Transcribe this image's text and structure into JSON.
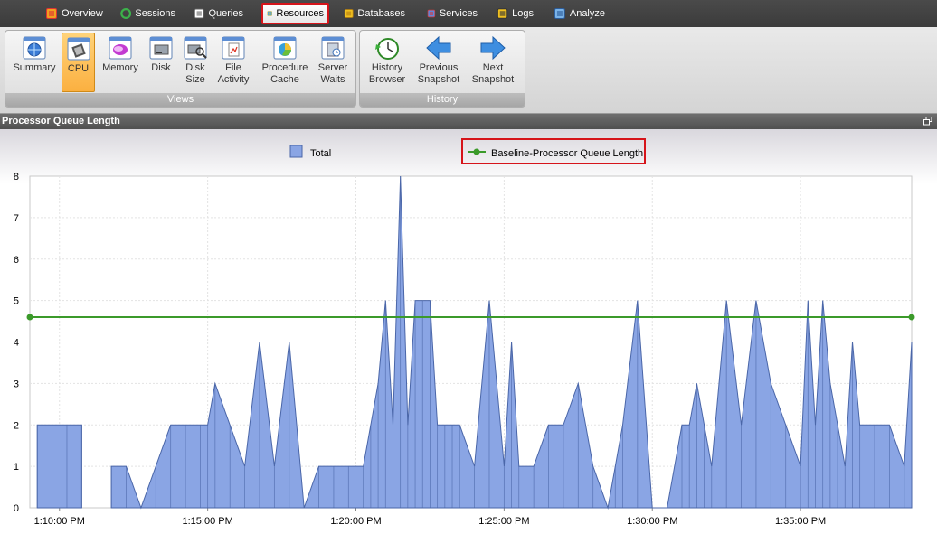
{
  "tabs": [
    {
      "label": "Overview",
      "icon": "overview-icon",
      "active": false
    },
    {
      "label": "Sessions",
      "icon": "sessions-icon",
      "active": false
    },
    {
      "label": "Queries",
      "icon": "queries-icon",
      "active": false
    },
    {
      "label": "Resources",
      "icon": "resources-icon",
      "active": true
    },
    {
      "label": "Databases",
      "icon": "databases-icon",
      "active": false
    },
    {
      "label": "Services",
      "icon": "services-icon",
      "active": false
    },
    {
      "label": "Logs",
      "icon": "logs-icon",
      "active": false
    },
    {
      "label": "Analyze",
      "icon": "analyze-icon",
      "active": false
    }
  ],
  "ribbon": {
    "views": {
      "label": "Views",
      "buttons": [
        {
          "line1": "Summary",
          "line2": "",
          "icon": "globe-icon",
          "active": false
        },
        {
          "line1": "CPU",
          "line2": "",
          "icon": "cpu-chip-icon",
          "active": true
        },
        {
          "line1": "Memory",
          "line2": "",
          "icon": "memory-icon",
          "active": false
        },
        {
          "line1": "Disk",
          "line2": "",
          "icon": "disk-icon",
          "active": false
        },
        {
          "line1": "Disk",
          "line2": "Size",
          "icon": "disk-size-icon",
          "active": false
        },
        {
          "line1": "File",
          "line2": "Activity",
          "icon": "file-activity-icon",
          "active": false
        },
        {
          "line1": "Procedure",
          "line2": "Cache",
          "icon": "procedure-cache-icon",
          "active": false
        },
        {
          "line1": "Server",
          "line2": "Waits",
          "icon": "server-waits-icon",
          "active": false
        }
      ]
    },
    "history": {
      "label": "History",
      "buttons": [
        {
          "line1": "History",
          "line2": "Browser",
          "icon": "clock-icon"
        },
        {
          "line1": "Previous",
          "line2": "Snapshot",
          "icon": "arrow-left-icon"
        },
        {
          "line1": "Next",
          "line2": "Snapshot",
          "icon": "arrow-right-icon"
        }
      ]
    }
  },
  "panel": {
    "title": "Processor Queue Length"
  },
  "colors": {
    "area_fill": "#8aa5e4",
    "area_stroke": "#4a66a8",
    "baseline": "#3b9a2a",
    "highlight": "#d6141a"
  },
  "chart_data": {
    "type": "area",
    "title": "",
    "xlabel": "",
    "ylabel": "",
    "ylim": [
      0,
      8
    ],
    "yticks": [
      0,
      1,
      2,
      3,
      4,
      5,
      6,
      7,
      8
    ],
    "xticks": [
      {
        "label": "1:10:00 PM",
        "minute": 10.0
      },
      {
        "label": "1:15:00 PM",
        "minute": 15.0
      },
      {
        "label": "1:20:00 PM",
        "minute": 20.0
      },
      {
        "label": "1:25:00 PM",
        "minute": 25.0
      },
      {
        "label": "1:30:00 PM",
        "minute": 30.0
      },
      {
        "label": "1:35:00 PM",
        "minute": 35.0
      }
    ],
    "x_range_minutes": [
      9.0,
      38.75
    ],
    "legend": [
      "Total",
      "Baseline-Processor Queue Length"
    ],
    "legend_placement": "top-center",
    "grid": true,
    "series": [
      {
        "name": "Total",
        "minutes": [
          9.25,
          9.75,
          10.25,
          10.75,
          10.76,
          11.75,
          12.25,
          12.75,
          13.25,
          13.75,
          14.25,
          14.75,
          15.0,
          15.25,
          15.75,
          16.25,
          16.75,
          17.25,
          17.75,
          18.25,
          18.75,
          19.25,
          19.75,
          20.25,
          20.5,
          20.75,
          21.0,
          21.25,
          21.5,
          21.75,
          22.0,
          22.25,
          22.5,
          22.75,
          23.0,
          23.25,
          23.5,
          24.0,
          24.5,
          25.0,
          25.25,
          25.5,
          26.0,
          26.5,
          27.0,
          27.5,
          28.0,
          28.5,
          28.75,
          29.0,
          29.5,
          30.0,
          30.5,
          31.0,
          31.25,
          31.5,
          31.75,
          32.0,
          32.5,
          33.0,
          33.5,
          34.0,
          34.5,
          35.0,
          35.25,
          35.5,
          35.75,
          36.0,
          36.25,
          36.5,
          36.75,
          37.0,
          37.5,
          38.0,
          38.5,
          38.75
        ],
        "values": [
          2,
          2,
          2,
          2,
          null,
          1,
          1,
          0,
          1,
          2,
          2,
          2,
          2,
          3,
          2,
          1,
          4,
          1,
          4,
          0,
          1,
          1,
          1,
          1,
          2,
          3,
          5,
          2,
          8,
          2,
          5,
          5,
          5,
          2,
          2,
          2,
          2,
          1,
          5,
          1,
          4,
          1,
          1,
          2,
          2,
          3,
          1,
          0,
          1,
          2,
          5,
          0,
          0,
          2,
          2,
          3,
          2,
          1,
          5,
          2,
          5,
          3,
          2,
          1,
          5,
          2,
          5,
          3,
          2,
          1,
          4,
          2,
          2,
          2,
          1,
          4
        ]
      },
      {
        "name": "Baseline-Processor Queue Length",
        "constant": 4.6
      }
    ]
  }
}
